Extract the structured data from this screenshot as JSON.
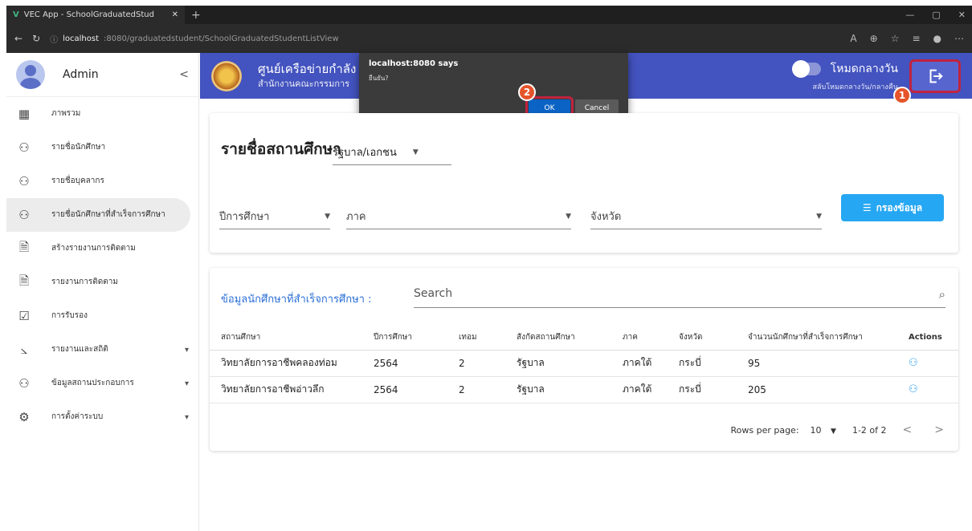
{
  "browser": {
    "tab_title": "VEC App - SchoolGraduatedStud",
    "url_host": "localhost",
    "url_rest": ":8080/graduatedstudent/SchoolGraduatedStudentListView"
  },
  "sidebar": {
    "user_name": "Admin",
    "items": [
      {
        "label": "ภาพรวม",
        "icon": "dashboard-icon"
      },
      {
        "label": "รายชื่อนักศึกษา",
        "icon": "users-icon"
      },
      {
        "label": "รายชื่อบุคลากร",
        "icon": "users-icon"
      },
      {
        "label": "รายชื่อนักศึกษาที่สำเร็จการศึกษา",
        "icon": "users-icon"
      },
      {
        "label": "สร้างรายงานการติดตาม",
        "icon": "document-icon"
      },
      {
        "label": "รายงานการติดตาม",
        "icon": "document-icon"
      },
      {
        "label": "การรับรอง",
        "icon": "clipboard-check-icon"
      },
      {
        "label": "รายงานและสถิติ",
        "icon": "chart-icon"
      },
      {
        "label": "ข้อมูลสถานประกอบการ",
        "icon": "users-icon"
      },
      {
        "label": "การตั้งค่าระบบ",
        "icon": "gear-icon"
      }
    ]
  },
  "header": {
    "title": "ศูนย์เครือข่ายกำลัง",
    "subtitle": "สำนักงานคณะกรรมการ",
    "mode_label": "โหมดกลางวัน",
    "mode_sub": "สลับโหมดกลางวัน/กลางคืน"
  },
  "dialog": {
    "title": "localhost:8080 says",
    "message": "ยืนยัน?",
    "ok_label": "OK",
    "cancel_label": "Cancel"
  },
  "badges": {
    "one": "1",
    "two": "2"
  },
  "filter": {
    "title": "รายชื่อสถานศึกษา",
    "sector_value": "รัฐบาล/เอกชน",
    "year_label": "ปีการศึกษา",
    "region_label": "ภาค",
    "province_label": "จังหวัด",
    "button_label": "กรองข้อมูล"
  },
  "table": {
    "title": "ข้อมูลนักศึกษาที่สำเร็จการศึกษา :",
    "search_placeholder": "Search",
    "headers": [
      "สถานศึกษา",
      "ปีการศึกษา",
      "เทอม",
      "สังกัดสถานศึกษา",
      "ภาค",
      "จังหวัด",
      "จำนวนนักศึกษาที่สำเร็จการศึกษา",
      "Actions"
    ],
    "rows": [
      [
        "วิทยาลัยการอาชีพคลองท่อม",
        "2564",
        "2",
        "รัฐบาล",
        "ภาคใต้",
        "กระบี่",
        "95"
      ],
      [
        "วิทยาลัยการอาชีพอ่าวลึก",
        "2564",
        "2",
        "รัฐบาล",
        "ภาคใต้",
        "กระบี่",
        "205"
      ]
    ],
    "rows_per_page_label": "Rows per page:",
    "rows_per_page_value": "10",
    "range_text": "1-2 of 2"
  },
  "colors": {
    "header": "#4353bf",
    "accent": "#26a7f3",
    "highlight": "#c0233f",
    "badge": "#e5542a"
  }
}
